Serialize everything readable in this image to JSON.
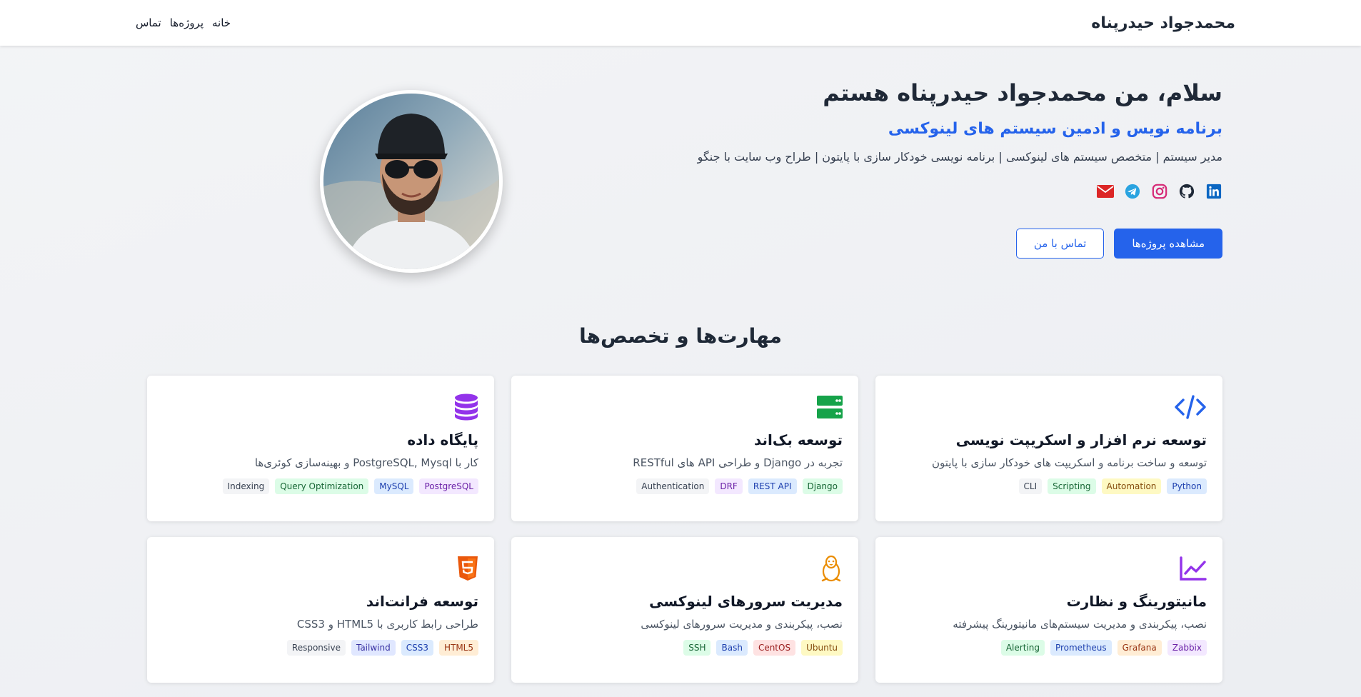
{
  "nav": {
    "brand": "محمدجواد حیدرپناه",
    "links": [
      "خانه",
      "پروژه‌ها",
      "تماس"
    ]
  },
  "hero": {
    "title": "سلام، من محمدجواد حیدرپناه هستم",
    "subtitle": "برنامه نویس و ادمین سیستم های لینوکسی",
    "description": "مدیر سیستم | متخصص سیستم های لینوکسی | برنامه نویسی خودکار سازی با پایتون | طراح وب سایت با جنگو",
    "social": [
      {
        "name": "linkedin-icon",
        "color": "#0a66c2"
      },
      {
        "name": "github-icon",
        "color": "#1f2937"
      },
      {
        "name": "instagram-icon",
        "color": "#d62976"
      },
      {
        "name": "telegram-icon",
        "color": "#2aa3e0"
      },
      {
        "name": "email-icon",
        "color": "#dc2626"
      }
    ],
    "primary_button": "مشاهده پروژه‌ها",
    "secondary_button": "تماس با من"
  },
  "skills": {
    "title": "مهارت‌ها و تخصص‌ها",
    "cards": [
      {
        "icon": "code-icon",
        "icon_color": "#2563eb",
        "title": "توسعه نرم افزار و اسکریپت نویسی",
        "desc": "توسعه و ساخت برنامه و اسکریپت های خودکار سازی با پایتون",
        "tags": [
          "Python",
          "Automation",
          "Scripting",
          "CLI"
        ]
      },
      {
        "icon": "server-icon",
        "icon_color": "#16a34a",
        "title": "توسعه بک‌اند",
        "desc": "تجربه در Django و طراحی API های RESTful",
        "tags": [
          "Django",
          "REST API",
          "DRF",
          "Authentication"
        ]
      },
      {
        "icon": "database-icon",
        "icon_color": "#9333ea",
        "title": "پایگاه داده",
        "desc": "کار با PostgreSQL, Mysql و بهینه‌سازی کوئری‌ها",
        "tags": [
          "PostgreSQL",
          "MySQL",
          "Query Optimization",
          "Indexing"
        ]
      },
      {
        "icon": "chart-line-icon",
        "icon_color": "#9333ea",
        "title": "مانیتورینگ و نظارت",
        "desc": "نصب، پیکربندی و مدیریت سیستم‌های مانیتورینگ پیشرفته",
        "tags": [
          "Zabbix",
          "Grafana",
          "Prometheus",
          "Alerting"
        ]
      },
      {
        "icon": "linux-icon",
        "icon_color": "#ea8c00",
        "title": "مدیریت سرورهای لینوکسی",
        "desc": "نصب، پیکربندی و مدیریت سرورهای لینوکسی",
        "tags": [
          "Ubuntu",
          "CentOS",
          "Bash",
          "SSH"
        ]
      },
      {
        "icon": "html5-icon",
        "icon_color": "#ea580c",
        "title": "توسعه فرانت‌اند",
        "desc": "طراحی رابط کاربری با HTML5 و CSS3",
        "tags": [
          "HTML5",
          "CSS3",
          "Tailwind",
          "Responsive"
        ]
      }
    ]
  }
}
